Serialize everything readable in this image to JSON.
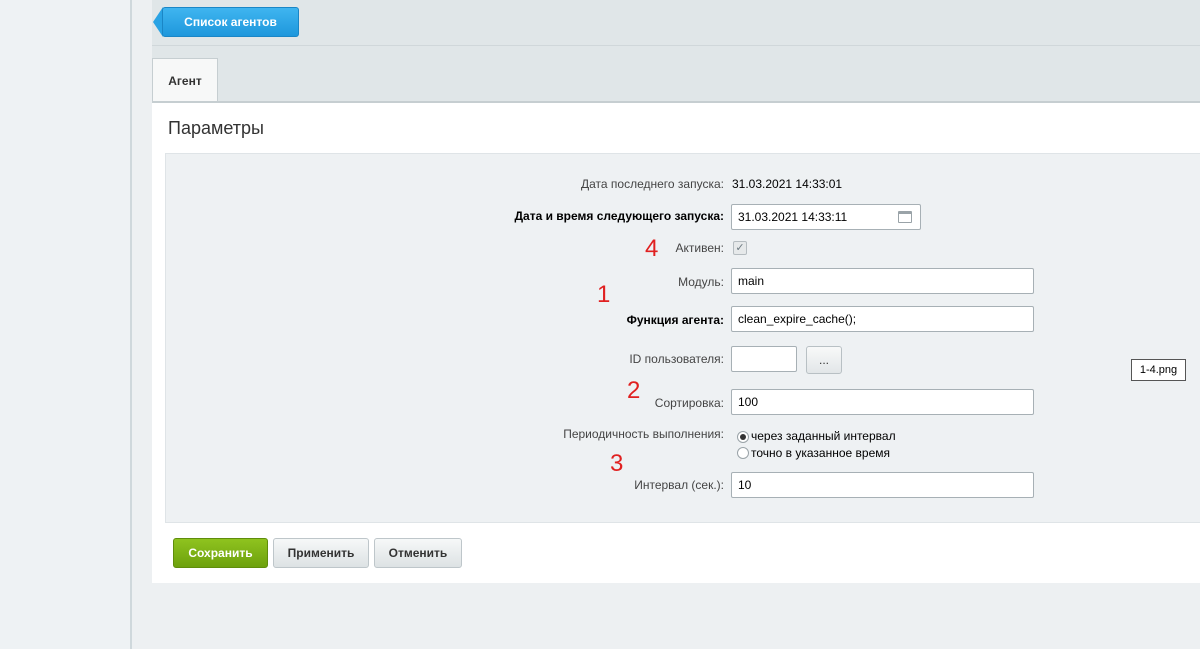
{
  "header": {
    "back_button_label": "Список агентов"
  },
  "tabs": [
    {
      "label": "Агент"
    }
  ],
  "section_title": "Параметры",
  "form": {
    "last_run_label": "Дата последнего запуска:",
    "last_run_value": "31.03.2021 14:33:01",
    "next_run_label": "Дата и время следующего запуска:",
    "next_run_value": "31.03.2021 14:33:11",
    "active_label": "Активен:",
    "active_checked": true,
    "module_label": "Модуль:",
    "module_value": "main",
    "function_label": "Функция агента:",
    "function_value": "clean_expire_cache();",
    "user_id_label": "ID пользователя:",
    "user_id_value": "",
    "user_picker_label": "...",
    "sort_label": "Сортировка:",
    "sort_value": "100",
    "periodicity_label": "Периодичность выполнения:",
    "periodicity_options": [
      {
        "label": "через заданный интервал",
        "selected": true
      },
      {
        "label": "точно в указанное время",
        "selected": false
      }
    ],
    "interval_label": "Интервал (сек.):",
    "interval_value": "10"
  },
  "buttons": {
    "save": "Сохранить",
    "apply": "Применить",
    "cancel": "Отменить"
  },
  "annotations": {
    "marker_1": "1",
    "marker_2": "2",
    "marker_3": "3",
    "marker_4": "4"
  },
  "file_tag": "1-4.png",
  "colors": {
    "accent_blue": "#1e97dc",
    "save_green": "#7ab317",
    "marker_red": "#e02020"
  }
}
